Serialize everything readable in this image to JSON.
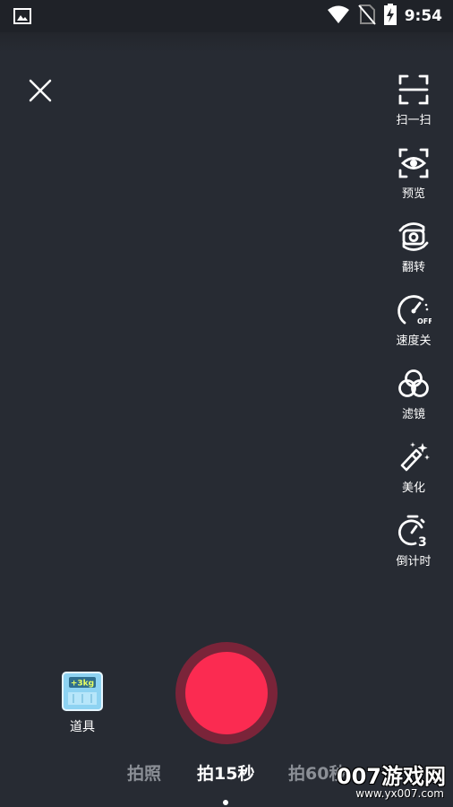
{
  "status_bar": {
    "time": "9:54",
    "icons": [
      "image-icon",
      "wifi-icon",
      "no-sim-icon",
      "battery-charging-icon"
    ]
  },
  "close_icon": "close-icon",
  "tools": [
    {
      "label": "扫一扫",
      "icon": "scan-icon"
    },
    {
      "label": "预览",
      "icon": "preview-eye-icon"
    },
    {
      "label": "翻转",
      "icon": "flip-camera-icon"
    },
    {
      "label": "速度关",
      "icon": "speed-off-icon"
    },
    {
      "label": "滤镜",
      "icon": "filter-icon"
    },
    {
      "label": "美化",
      "icon": "beautify-wand-icon"
    },
    {
      "label": "倒计时",
      "icon": "countdown-timer-icon"
    }
  ],
  "props": {
    "label": "道具",
    "badge": "+3kg"
  },
  "modes": [
    {
      "label": "拍照",
      "active": false
    },
    {
      "label": "拍15秒",
      "active": true
    },
    {
      "label": "拍60秒",
      "active": false
    }
  ],
  "watermark": {
    "title": "007游戏网",
    "url": "www.yx007.com"
  },
  "colors": {
    "background": "#272b33",
    "record": "#fb2b51",
    "record_ring": "#7a2439"
  }
}
